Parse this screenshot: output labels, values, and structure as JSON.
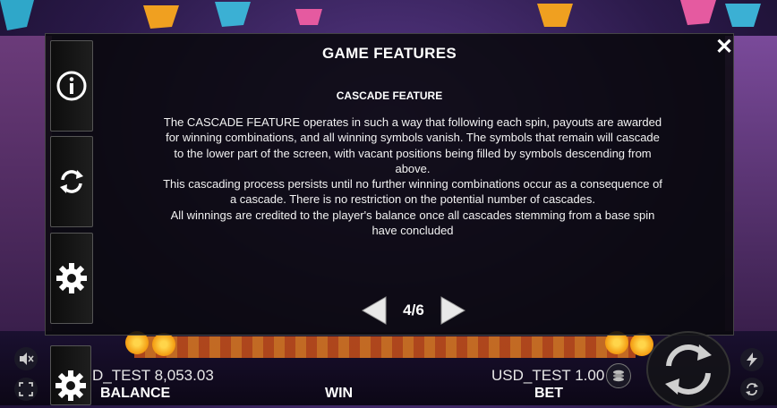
{
  "modal": {
    "title": "GAME FEATURES",
    "section_title": "CASCADE FEATURE",
    "paragraphs": [
      "The CASCADE FEATURE operates in such a way that following each spin, payouts are awarded for winning combinations, and all winning symbols vanish. The symbols that remain will cascade to the lower part of the screen, with vacant positions being filled by symbols descending from above.",
      "This cascading process persists until no further winning combinations occur as a consequence of a cascade. There is no restriction on the potential number of cascades.",
      "All winnings are credited to the player's balance once all cascades stemming from a base spin have concluded"
    ],
    "page_indicator": "4/6",
    "close_icon": "close-icon"
  },
  "side_menu": {
    "items": [
      {
        "icon": "info-icon"
      },
      {
        "icon": "autoplay-icon"
      },
      {
        "icon": "settings-icon"
      },
      {
        "icon": "settings-icon"
      }
    ]
  },
  "hud": {
    "balance_value": "D_TEST 8,053.03",
    "balance_label": "BALANCE",
    "win_label": "WIN",
    "bet_value": "USD_TEST 1.00",
    "bet_label": "BET"
  },
  "colors": {
    "modal_bg": "#08080c",
    "text": "#ffffff",
    "accent_orange": "#e07a22"
  }
}
